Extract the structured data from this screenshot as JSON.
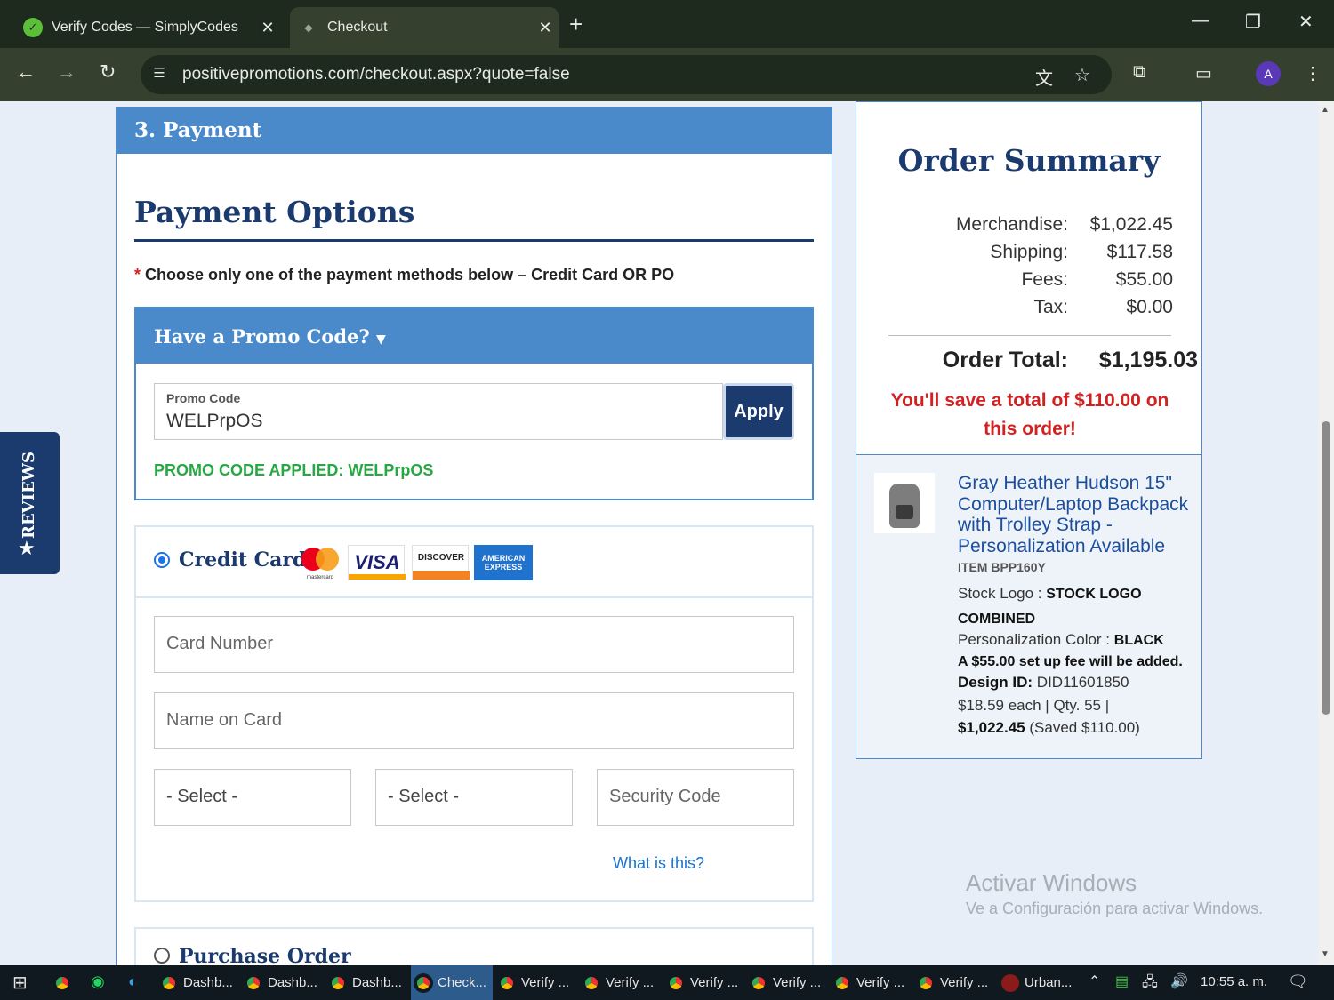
{
  "browser": {
    "tabs": [
      {
        "title": "Verify Codes — SimplyCodes",
        "active": false
      },
      {
        "title": "Checkout",
        "active": true
      }
    ],
    "url": "positivepromotions.com/checkout.aspx?quote=false",
    "profile_initial": "A"
  },
  "checkout": {
    "step_header": "3. Payment",
    "payment_options_title": "Payment Options",
    "instruction_star": "*",
    "instruction": "Choose only one of the payment methods below – Credit Card OR PO",
    "promo": {
      "header": "Have a Promo Code?",
      "field_label": "Promo Code",
      "field_value": "WELPrpOS",
      "apply_label": "Apply",
      "applied_message": "PROMO CODE APPLIED: WELPrpOS"
    },
    "credit_card": {
      "label": "Credit Card",
      "selected": true,
      "logos": {
        "visa": "VISA",
        "discover": "DISCOVER",
        "amex": "AMERICAN EXPRESS",
        "mastercard": "mastercard"
      },
      "card_number_placeholder": "Card Number",
      "name_placeholder": "Name on Card",
      "month_select": "- Select -",
      "year_select": "- Select -",
      "security_placeholder": "Security Code",
      "what_is_this": "What is this?"
    },
    "purchase_order": {
      "label": "Purchase Order",
      "selected": false
    },
    "reviews_tab": "REVIEWS"
  },
  "order_summary": {
    "title": "Order Summary",
    "rows": [
      {
        "label": "Merchandise:",
        "value": "$1,022.45"
      },
      {
        "label": "Shipping:",
        "value": "$117.58"
      },
      {
        "label": "Fees:",
        "value": "$55.00"
      },
      {
        "label": "Tax:",
        "value": "$0.00"
      }
    ],
    "total_label": "Order Total:",
    "total_value": "$1,195.03",
    "savings_message": "You'll save a total of $110.00 on this order!",
    "item": {
      "title": "Gray Heather Hudson 15\" Computer/Laptop Backpack with Trolley Strap - Personalization Available",
      "sku": "ITEM BPP160Y",
      "stock_logo_label": "Stock Logo :",
      "stock_logo_value": "STOCK LOGO",
      "stock_logo_value2": "COMBINED",
      "color_label": "Personalization Color :",
      "color_value": "BLACK",
      "setup_fee": "A $55.00 set up fee will be added.",
      "design_label": "Design ID:",
      "design_value": "DID11601850",
      "price_line": "$18.59 each | Qty. 55 |",
      "line_total": "$1,022.45",
      "saved": "(Saved $110.00)"
    }
  },
  "watermark": {
    "line1": "Activar Windows",
    "line2": "Ve a Configuración para activar Windows."
  },
  "taskbar": {
    "items": [
      "Dashb...",
      "Dashb...",
      "Dashb...",
      "Check...",
      "Verify ...",
      "Verify ...",
      "Verify ...",
      "Verify ...",
      "Verify ...",
      "Verify ...",
      "Urban..."
    ],
    "active_index": 3,
    "time": "10:55 a. m."
  },
  "colors": {
    "accent_blue": "#4a8acb",
    "navy": "#1b3a6e",
    "success_green": "#28a745",
    "alert_red": "#d32020"
  }
}
